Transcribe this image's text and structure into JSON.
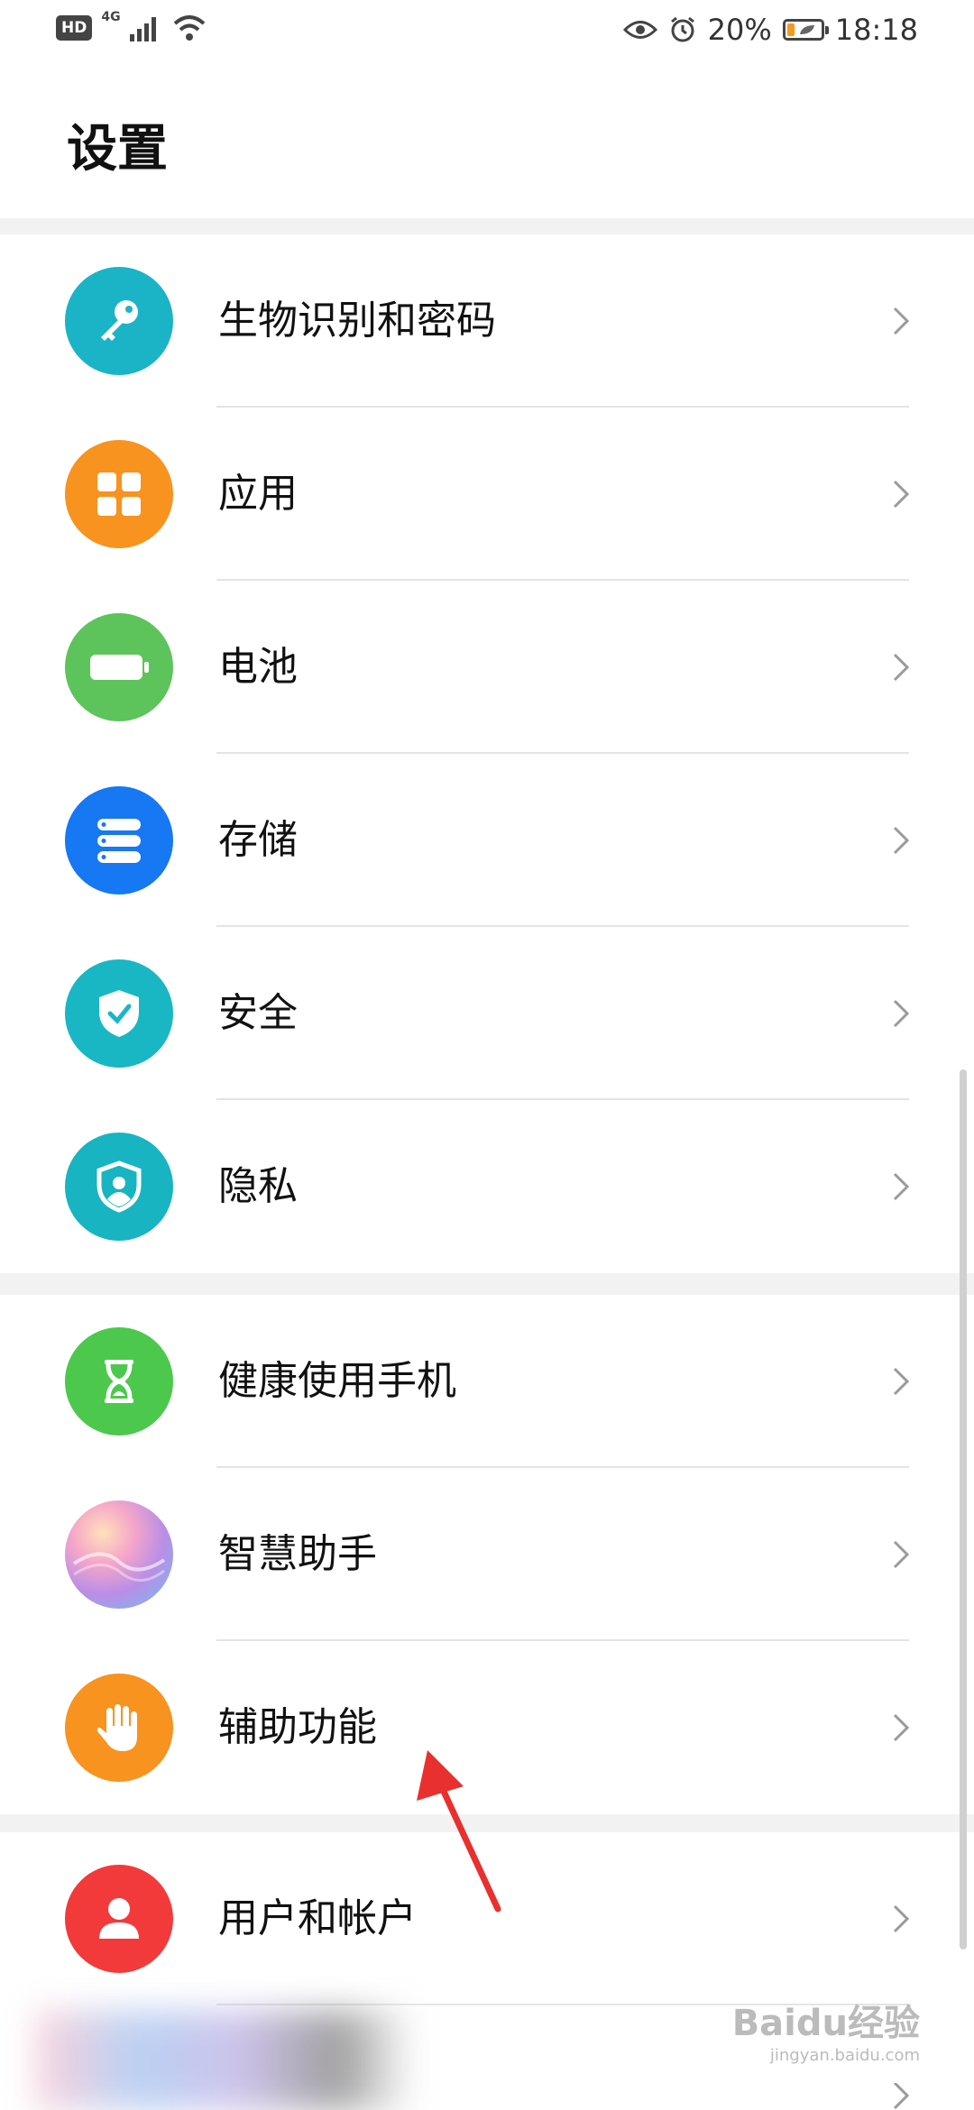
{
  "status_bar": {
    "hd": "HD",
    "network": "4G",
    "battery_percent": "20%",
    "time": "18:18",
    "icons": [
      "signal-icon",
      "wifi-icon",
      "eye-icon",
      "alarm-icon",
      "battery-icon"
    ]
  },
  "page": {
    "title": "设置"
  },
  "groups": [
    {
      "items": [
        {
          "label": "生物识别和密码",
          "icon": "key-icon",
          "color": "#1BB4C6"
        },
        {
          "label": "应用",
          "icon": "apps-icon",
          "color": "#F7931E"
        },
        {
          "label": "电池",
          "icon": "battery-icon",
          "color": "#5CC45A"
        },
        {
          "label": "存储",
          "icon": "storage-icon",
          "color": "#1678F2"
        },
        {
          "label": "安全",
          "icon": "shield-check-icon",
          "color": "#19B7C4"
        },
        {
          "label": "隐私",
          "icon": "privacy-shield-icon",
          "color": "#18B4C2"
        }
      ]
    },
    {
      "items": [
        {
          "label": "健康使用手机",
          "icon": "hourglass-icon",
          "color": "#4CC94C"
        },
        {
          "label": "智慧助手",
          "icon": "assistant-icon",
          "color": "#C9A6E8"
        },
        {
          "label": "辅助功能",
          "icon": "hand-icon",
          "color": "#F7931E"
        }
      ]
    },
    {
      "items": [
        {
          "label": "用户和帐户",
          "icon": "user-icon",
          "color": "#F23A3A"
        }
      ]
    }
  ],
  "annotation": {
    "arrow_color": "#E8302F"
  },
  "watermark": {
    "brand": "Baidu经验",
    "url": "jingyan.baidu.com"
  }
}
